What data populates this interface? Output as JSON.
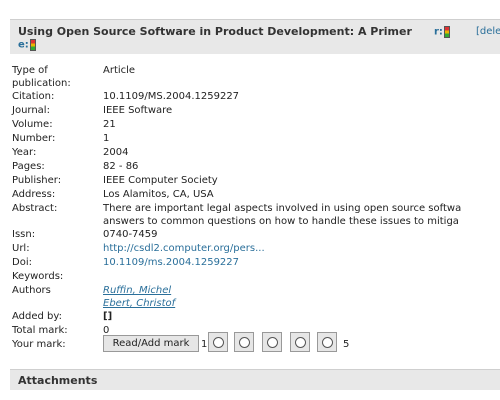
{
  "header": {
    "title": "Using Open Source Software in Product Development: A Primer",
    "r_label": "r:",
    "e_label": "e:",
    "delete_label": "[dele"
  },
  "fields": {
    "type_label": "Type of publication:",
    "type_value": "Article",
    "citation_label": "Citation:",
    "citation_value": "10.1109/MS.2004.1259227",
    "journal_label": "Journal:",
    "journal_value": "IEEE Software",
    "volume_label": "Volume:",
    "volume_value": "21",
    "number_label": "Number:",
    "number_value": "1",
    "year_label": "Year:",
    "year_value": "2004",
    "pages_label": "Pages:",
    "pages_value": "82 - 86",
    "publisher_label": "Publisher:",
    "publisher_value": "IEEE Computer Society",
    "address_label": "Address:",
    "address_value": "Los Alamitos, CA, USA",
    "abstract_label": "Abstract:",
    "abstract_line1": "There are important legal aspects involved in using open source softwa",
    "abstract_line2": "answers to common questions on how to handle these issues to mitiga",
    "issn_label": "Issn:",
    "issn_value": "0740-7459",
    "url_label": "Url:",
    "url_value": "http://csdl2.computer.org/pers...",
    "doi_label": "Doi:",
    "doi_value": "10.1109/ms.2004.1259227",
    "keywords_label": "Keywords:",
    "authors_label": "Authors",
    "authors": [
      "Ruffin, Michel",
      "Ebert, Christof"
    ],
    "added_by_label": "Added by:",
    "added_by_value": "[]",
    "total_mark_label": "Total mark:",
    "total_mark_value": "0",
    "your_mark_label": "Your mark:"
  },
  "rating": {
    "button_label": "Read/Add mark",
    "min_label": "1",
    "max_label": "5"
  },
  "attachments": {
    "title": "Attachments"
  }
}
